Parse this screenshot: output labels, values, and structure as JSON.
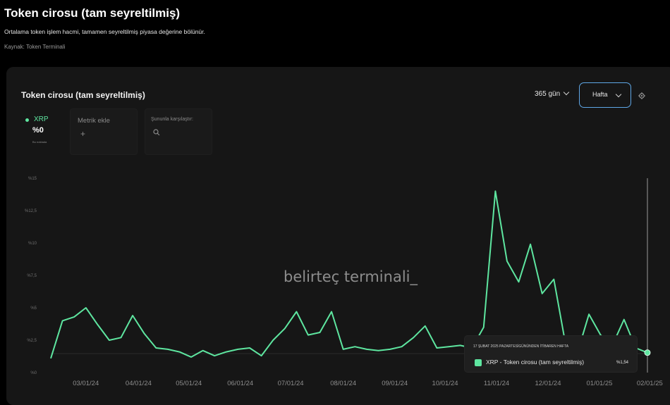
{
  "page": {
    "title": "Token cirosu (tam seyreltilmiş)",
    "subtitle": "Ortalama token işlem hacmi, tamamen seyreltilmiş piyasa değerine bölünür.",
    "source": "Kaynak: Token Terminali"
  },
  "card": {
    "title": "Token cirosu (tam seyreltilmiş)",
    "range_label": "365 gün",
    "interval_label": "Hafta",
    "settings_icon": "gear-icon"
  },
  "metrics": {
    "xrp": {
      "label": "XRP",
      "value": "%0",
      "sub": "Bu noktada"
    },
    "add": {
      "label": "Metrik ekle",
      "icon": "plus-icon"
    },
    "compare": {
      "label": "Şununla karşılaştır:",
      "icon": "search-icon"
    }
  },
  "watermark": "belirteç terminali_",
  "tooltip": {
    "header": "17 ŞUBAT 2025 PAZARTESİGÜNÜNDEN İTİBAREN HAFTA",
    "series_name": "XRP - Token cirosu (tam seyreltilmiş)",
    "value": "%1,54"
  },
  "colors": {
    "series": "#5ee6a0",
    "accent_border": "#5fa7e6",
    "background": "#000000",
    "card": "#161616"
  },
  "chart_data": {
    "type": "line",
    "ylim": [
      0,
      15
    ],
    "y_ticks": [
      {
        "value": 0,
        "label": "%0"
      },
      {
        "value": 2.5,
        "label": "%2,5"
      },
      {
        "value": 5,
        "label": "%5"
      },
      {
        "value": 7.5,
        "label": "%7,5"
      },
      {
        "value": 10,
        "label": "%10"
      },
      {
        "value": 12.5,
        "label": "%12,5"
      },
      {
        "value": 15,
        "label": "%15"
      }
    ],
    "x_ticks": [
      {
        "x": 3,
        "label": "03/01/24"
      },
      {
        "x": 7.5,
        "label": "04/01/24"
      },
      {
        "x": 11.8,
        "label": "05/01/24"
      },
      {
        "x": 16.2,
        "label": "06/01/24"
      },
      {
        "x": 20.5,
        "label": "07/01/24"
      },
      {
        "x": 25,
        "label": "08/01/24"
      },
      {
        "x": 29.4,
        "label": "09/01/24"
      },
      {
        "x": 33.7,
        "label": "10/01/24"
      },
      {
        "x": 38.1,
        "label": "11/01/24"
      },
      {
        "x": 42.5,
        "label": "12/01/24"
      },
      {
        "x": 46.9,
        "label": "01/01/25"
      },
      {
        "x": 51.2,
        "label": "02/01/25"
      }
    ],
    "series": [
      {
        "name": "XRP - Token cirosu (tam seyreltilmiş)",
        "values": [
          1.1,
          4.0,
          4.3,
          5.0,
          3.7,
          2.5,
          2.7,
          4.4,
          3.0,
          1.9,
          1.8,
          1.6,
          1.2,
          1.7,
          1.3,
          1.6,
          1.8,
          1.9,
          1.3,
          2.5,
          3.4,
          4.7,
          2.9,
          3.1,
          4.7,
          1.8,
          2.0,
          1.8,
          1.7,
          1.8,
          2.0,
          2.7,
          3.6,
          1.9,
          2.0,
          2.1,
          1.9,
          3.5,
          14.0,
          8.6,
          7.0,
          9.9,
          6.1,
          7.2,
          2.2,
          1.5,
          4.5,
          2.9,
          2.1,
          4.1,
          1.9,
          1.54
        ]
      }
    ],
    "grid": false,
    "legend": "none"
  }
}
